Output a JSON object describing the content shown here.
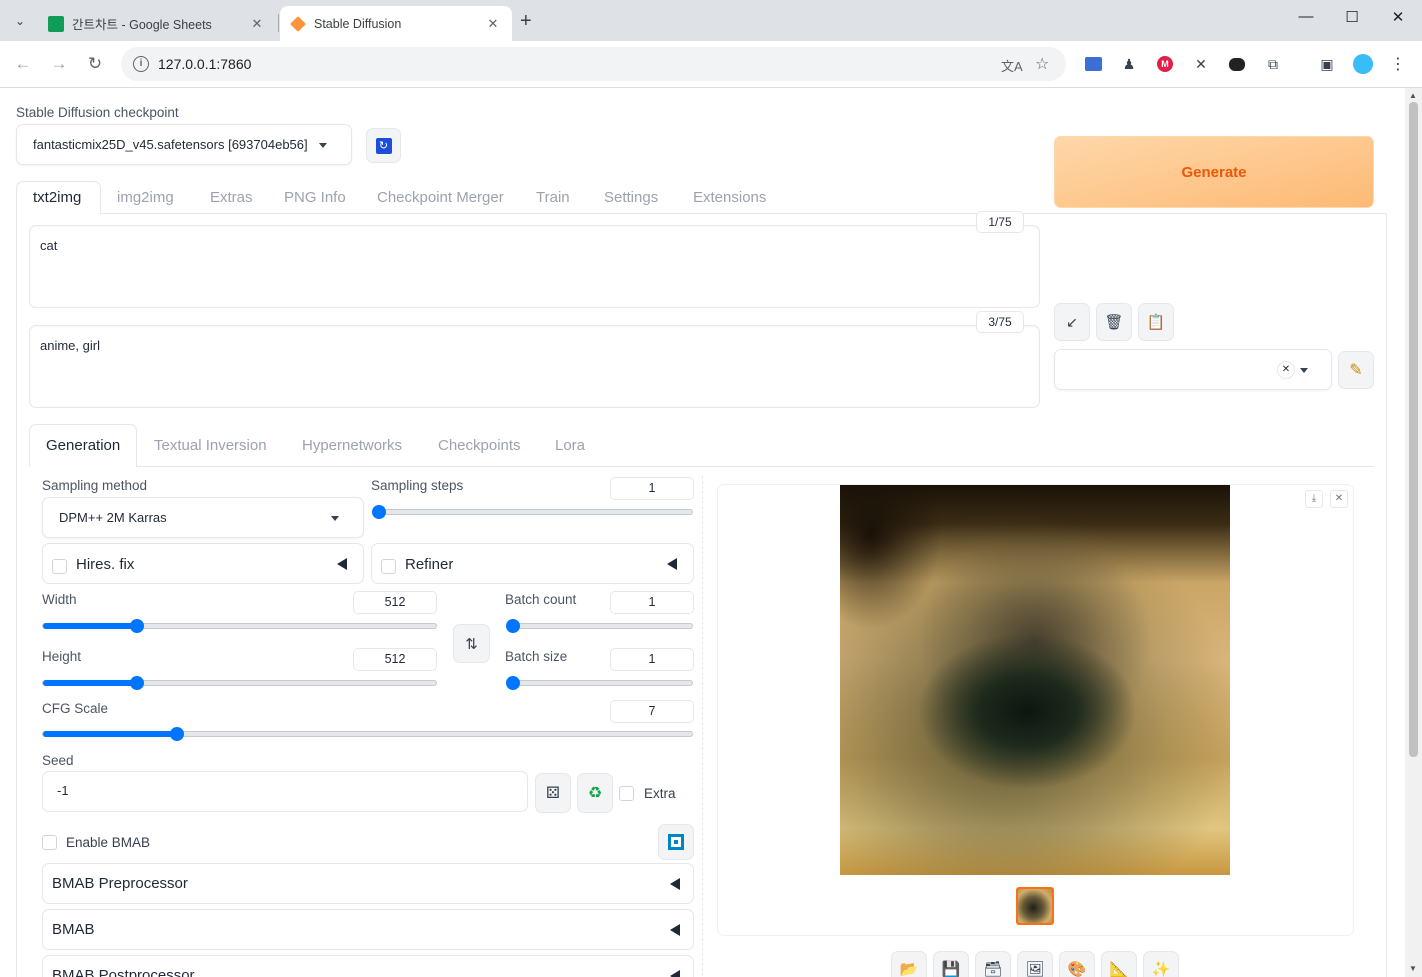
{
  "browser": {
    "tabs": [
      {
        "title": "간트차트 - Google Sheets"
      },
      {
        "title": "Stable Diffusion"
      }
    ],
    "url": "127.0.0.1:7860"
  },
  "checkpoint": {
    "label": "Stable Diffusion checkpoint",
    "value": "fantasticmix25D_v45.safetensors [693704eb56]"
  },
  "main_tabs": [
    "txt2img",
    "img2img",
    "Extras",
    "PNG Info",
    "Checkpoint Merger",
    "Train",
    "Settings",
    "Extensions"
  ],
  "prompt": {
    "text": "cat",
    "counter": "1/75"
  },
  "negative_prompt": {
    "text": "anime, girl",
    "counter": "3/75"
  },
  "generate_label": "Generate",
  "sub_tabs": [
    "Generation",
    "Textual Inversion",
    "Hypernetworks",
    "Checkpoints",
    "Lora"
  ],
  "sampling": {
    "method_label": "Sampling method",
    "method_value": "DPM++ 2M Karras",
    "steps_label": "Sampling steps",
    "steps_value": "1",
    "steps_fraction": 0.0
  },
  "hires_label": "Hires. fix",
  "refiner_label": "Refiner",
  "width": {
    "label": "Width",
    "value": "512",
    "fraction": 0.2381
  },
  "height": {
    "label": "Height",
    "value": "512",
    "fraction": 0.2381
  },
  "batch_count": {
    "label": "Batch count",
    "value": "1",
    "fraction": 0.0
  },
  "batch_size": {
    "label": "Batch size",
    "value": "1",
    "fraction": 0.0
  },
  "cfg": {
    "label": "CFG Scale",
    "value": "7",
    "fraction": 0.2069
  },
  "seed": {
    "label": "Seed",
    "value": "-1",
    "extra_label": "Extra"
  },
  "bmab": {
    "enable_label": "Enable BMAB",
    "accordions": [
      "BMAB Preprocessor",
      "BMAB",
      "BMAB Postprocessor"
    ]
  },
  "colors": {
    "accent": "#0075ff",
    "generate_text": "#ea580c",
    "selected_thumb": "#f97316"
  },
  "icons": {
    "refresh": "refresh-icon",
    "swap": "swap-icon",
    "dice": "dice-icon",
    "recycle": "recycle-icon"
  }
}
